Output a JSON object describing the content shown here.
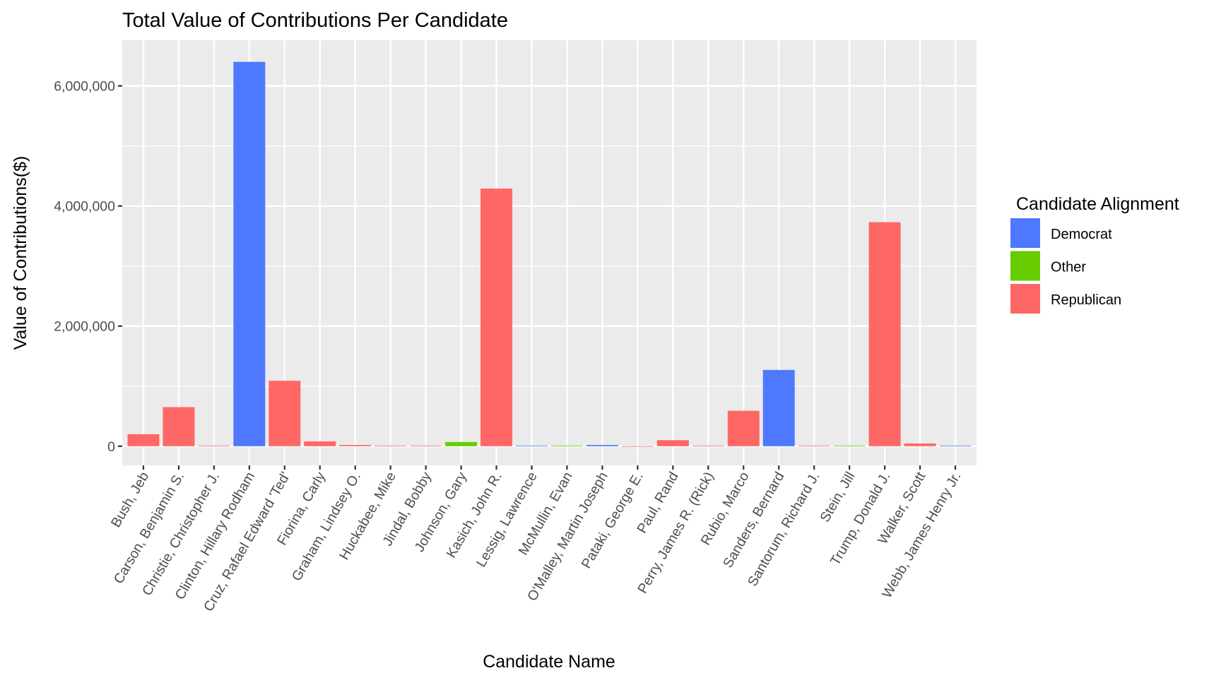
{
  "chart_data": {
    "type": "bar",
    "title": "Total Value of Contributions Per Candidate",
    "xlabel": "Candidate Name",
    "ylabel": "Value of Contributions($)",
    "ylim": [
      -320000,
      6760000
    ],
    "yticks": [
      0,
      2000000,
      4000000,
      6000000
    ],
    "ytick_labels": [
      "0",
      "2,000,000",
      "4,000,000",
      "6,000,000"
    ],
    "grid": true,
    "legend": {
      "title": "Candidate Alignment",
      "position": "right",
      "entries": [
        {
          "name": "Democrat",
          "color": "#4e79ff"
        },
        {
          "name": "Other",
          "color": "#66cc00"
        },
        {
          "name": "Republican",
          "color": "#ff6666"
        }
      ]
    },
    "categories": [
      "Bush, Jeb",
      "Carson, Benjamin S.",
      "Christie, Christopher J.",
      "Clinton, Hillary Rodham",
      "Cruz, Rafael Edward 'Ted'",
      "Fiorina, Carly",
      "Graham, Lindsey O.",
      "Huckabee, Mike",
      "Jindal, Bobby",
      "Johnson, Gary",
      "Kasich, John R.",
      "Lessig, Lawrence",
      "McMullin, Evan",
      "O'Malley, Martin Joseph",
      "Pataki, George E.",
      "Paul, Rand",
      "Perry, James R. (Rick)",
      "Rubio, Marco",
      "Sanders, Bernard",
      "Santorum, Richard J.",
      "Stein, Jill",
      "Trump, Donald J.",
      "Walker, Scott",
      "Webb, James Henry Jr."
    ],
    "values": [
      200000,
      650000,
      10000,
      6400000,
      1090000,
      80000,
      20000,
      10000,
      10000,
      70000,
      4290000,
      10000,
      10000,
      20000,
      2000,
      100000,
      10000,
      590000,
      1270000,
      10000,
      10000,
      3730000,
      45000,
      10000
    ],
    "alignment": [
      "Republican",
      "Republican",
      "Republican",
      "Democrat",
      "Republican",
      "Republican",
      "Republican",
      "Republican",
      "Republican",
      "Other",
      "Republican",
      "Democrat",
      "Other",
      "Democrat",
      "Republican",
      "Republican",
      "Republican",
      "Republican",
      "Democrat",
      "Republican",
      "Other",
      "Republican",
      "Republican",
      "Democrat"
    ]
  }
}
